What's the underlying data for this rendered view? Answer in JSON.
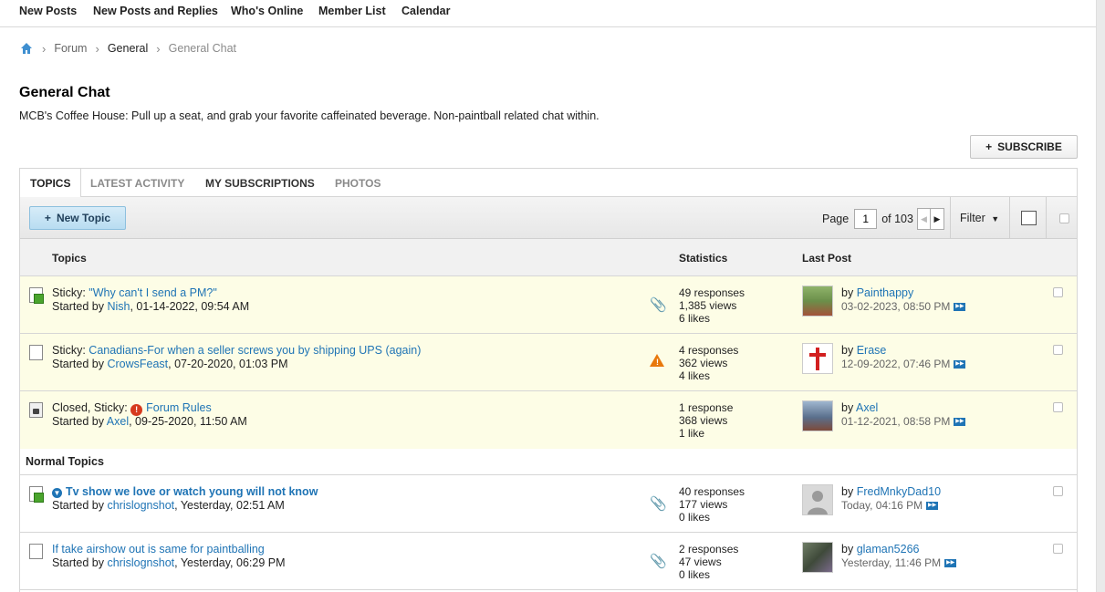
{
  "topnav": [
    "New Posts",
    "New Posts and Replies",
    "Who's Online",
    "Member List",
    "Calendar"
  ],
  "breadcrumb": {
    "items": [
      "Forum",
      "General",
      "General Chat"
    ],
    "separator": "›"
  },
  "page": {
    "title": "General Chat",
    "description": "MCB's Coffee House: Pull up a seat, and grab your favorite caffeinated beverage. Non-paintball related chat within.",
    "subscribe_label": "SUBSCRIBE"
  },
  "tabs": [
    "TOPICS",
    "LATEST ACTIVITY",
    "MY SUBSCRIPTIONS",
    "PHOTOS"
  ],
  "toolbar": {
    "new_topic_label": "New Topic",
    "page_label": "Page",
    "page_value": "1",
    "of_label": "of 103",
    "filter_label": "Filter"
  },
  "columns": {
    "topics": "Topics",
    "statistics": "Statistics",
    "last_post": "Last Post"
  },
  "section_label": "Normal Topics",
  "rows": [
    {
      "prefix": "Sticky:",
      "title": "\"Why can't I send a PM?\"",
      "started_by_label": "Started by",
      "author": "Nish",
      "date": ", 01-14-2022, 09:54 AM",
      "responses": "49 responses",
      "views": "1,385 views",
      "likes": "6 likes",
      "last_by_label": "by",
      "last_user": "Painthappy",
      "last_date": "03-02-2023, 08:50 PM",
      "marker": "attachment-icon",
      "colors": {
        "avatar": "#6b8f4a"
      }
    },
    {
      "prefix": "Sticky:",
      "title": "Canadians-For when a seller screws you by shipping UPS (again)",
      "started_by_label": "Started by",
      "author": "CrowsFeast",
      "date": ", 07-20-2020, 01:03 PM",
      "responses": "4 responses",
      "views": "362 views",
      "likes": "4 likes",
      "last_by_label": "by",
      "last_user": "Erase",
      "last_date": "12-09-2022, 07:46 PM",
      "marker": "warning-icon",
      "colors": {
        "avatar": "#ffffff"
      }
    },
    {
      "prefix": "Closed, Sticky:",
      "title": "Forum Rules",
      "started_by_label": "Started by",
      "author": "Axel",
      "date": ", 09-25-2020, 11:50 AM",
      "responses": "1 response",
      "views": "368 views",
      "likes": "1 like",
      "last_by_label": "by",
      "last_user": "Axel",
      "last_date": "01-12-2021, 08:58 PM",
      "marker": "",
      "colors": {
        "avatar": "#5a6f8c"
      }
    },
    {
      "prefix": "",
      "title": "Tv show we love or watch young will not know",
      "started_by_label": "Started by",
      "author": "chrislognshot",
      "date": ", Yesterday, 02:51 AM",
      "responses": "40 responses",
      "views": "177 views",
      "likes": "0 likes",
      "last_by_label": "by",
      "last_user": "FredMnkyDad10",
      "last_date": "Today, 04:16 PM",
      "marker": "attachment-icon",
      "colors": {
        "avatar": "#c9c9c9"
      }
    },
    {
      "prefix": "",
      "title": "If take airshow out is same for paintballing",
      "started_by_label": "Started by",
      "author": "chrislognshot",
      "date": ", Yesterday, 06:29 PM",
      "responses": "2 responses",
      "views": "47 views",
      "likes": "0 likes",
      "last_by_label": "by",
      "last_user": "glaman5266",
      "last_date": "Yesterday, 11:46 PM",
      "marker": "attachment-icon",
      "colors": {
        "avatar": "#3f4a3a"
      }
    }
  ]
}
